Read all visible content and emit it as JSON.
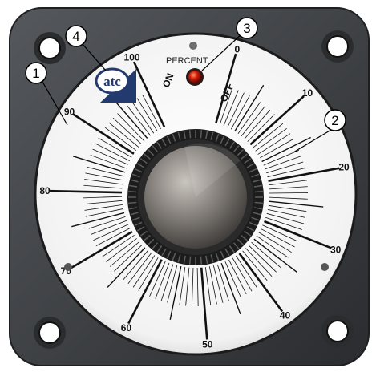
{
  "dial": {
    "scale_labels": [
      "0",
      "10",
      "20",
      "30",
      "40",
      "50",
      "60",
      "70",
      "80",
      "90",
      "100"
    ],
    "on_label": "ON",
    "off_label": "OFF",
    "percent_label": "PERCENT",
    "logo_text": "atc"
  },
  "callouts": [
    {
      "number": "1",
      "target": "dial-face"
    },
    {
      "number": "2",
      "target": "scale-ticks"
    },
    {
      "number": "3",
      "target": "indicator-lamp"
    },
    {
      "number": "4",
      "target": "logo"
    }
  ],
  "colors": {
    "housing": "#3d3f42",
    "face": "#f4f4f4",
    "lamp": "#d01c0c",
    "knob": "#8a8580"
  }
}
